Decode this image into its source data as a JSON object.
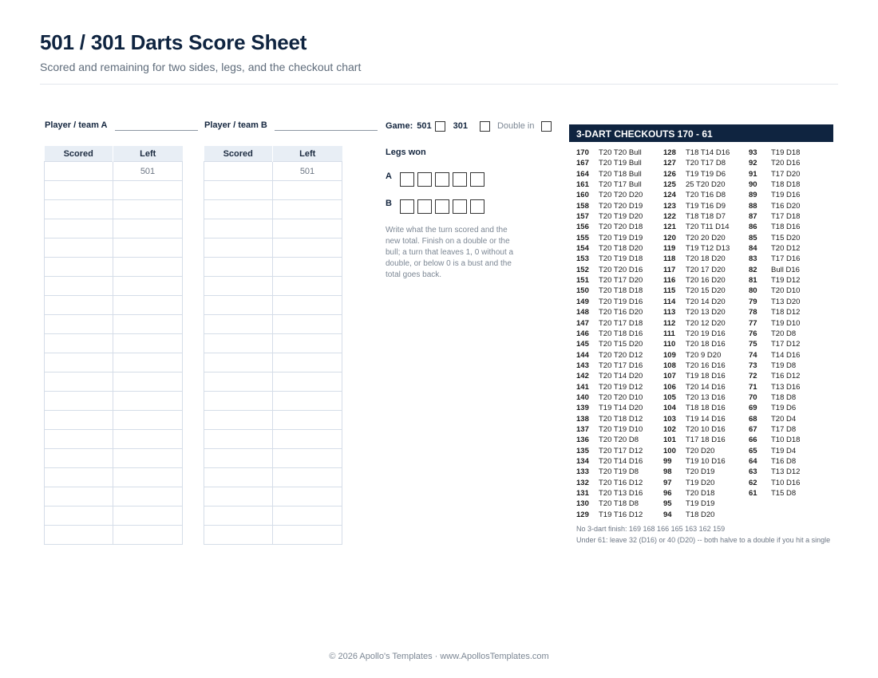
{
  "header": {
    "title": "501 / 301 Darts Score Sheet",
    "subtitle": "Scored and remaining for two sides, legs, and the checkout chart"
  },
  "players": {
    "a_label": "Player / team A",
    "b_label": "Player / team B"
  },
  "game": {
    "label": "Game:",
    "opt1": "501",
    "opt2": "301",
    "double_in": "Double in"
  },
  "sheet": {
    "col_scored": "Scored",
    "col_left": "Left",
    "start_left": "501",
    "rows": 20
  },
  "legs": {
    "title": "Legs won",
    "row_a": "A",
    "row_b": "B",
    "boxes": 5
  },
  "note": "Write what the turn scored and the new total. Finish on a double or the bull; a turn that leaves 1, 0 without a double, or below 0 is a bust and the total goes back.",
  "checkouts": {
    "heading": "3-DART CHECKOUTS  170 - 61",
    "columns": [
      [
        [
          "170",
          "T20 T20 Bull"
        ],
        [
          "167",
          "T20 T19 Bull"
        ],
        [
          "164",
          "T20 T18 Bull"
        ],
        [
          "161",
          "T20 T17 Bull"
        ],
        [
          "160",
          "T20 T20 D20"
        ],
        [
          "158",
          "T20 T20 D19"
        ],
        [
          "157",
          "T20 T19 D20"
        ],
        [
          "156",
          "T20 T20 D18"
        ],
        [
          "155",
          "T20 T19 D19"
        ],
        [
          "154",
          "T20 T18 D20"
        ],
        [
          "153",
          "T20 T19 D18"
        ],
        [
          "152",
          "T20 T20 D16"
        ],
        [
          "151",
          "T20 T17 D20"
        ],
        [
          "150",
          "T20 T18 D18"
        ],
        [
          "149",
          "T20 T19 D16"
        ],
        [
          "148",
          "T20 T16 D20"
        ],
        [
          "147",
          "T20 T17 D18"
        ],
        [
          "146",
          "T20 T18 D16"
        ],
        [
          "145",
          "T20 T15 D20"
        ],
        [
          "144",
          "T20 T20 D12"
        ],
        [
          "143",
          "T20 T17 D16"
        ],
        [
          "142",
          "T20 T14 D20"
        ],
        [
          "141",
          "T20 T19 D12"
        ],
        [
          "140",
          "T20 T20 D10"
        ],
        [
          "139",
          "T19 T14 D20"
        ],
        [
          "138",
          "T20 T18 D12"
        ],
        [
          "137",
          "T20 T19 D10"
        ],
        [
          "136",
          "T20 T20 D8"
        ],
        [
          "135",
          "T20 T17 D12"
        ],
        [
          "134",
          "T20 T14 D16"
        ],
        [
          "133",
          "T20 T19 D8"
        ],
        [
          "132",
          "T20 T16 D12"
        ],
        [
          "131",
          "T20 T13 D16"
        ],
        [
          "130",
          "T20 T18 D8"
        ],
        [
          "129",
          "T19 T16 D12"
        ]
      ],
      [
        [
          "128",
          "T18 T14 D16"
        ],
        [
          "127",
          "T20 T17 D8"
        ],
        [
          "126",
          "T19 T19 D6"
        ],
        [
          "125",
          "25 T20 D20"
        ],
        [
          "124",
          "T20 T16 D8"
        ],
        [
          "123",
          "T19 T16 D9"
        ],
        [
          "122",
          "T18 T18 D7"
        ],
        [
          "121",
          "T20 T11 D14"
        ],
        [
          "120",
          "T20 20 D20"
        ],
        [
          "119",
          "T19 T12 D13"
        ],
        [
          "118",
          "T20 18 D20"
        ],
        [
          "117",
          "T20 17 D20"
        ],
        [
          "116",
          "T20 16 D20"
        ],
        [
          "115",
          "T20 15 D20"
        ],
        [
          "114",
          "T20 14 D20"
        ],
        [
          "113",
          "T20 13 D20"
        ],
        [
          "112",
          "T20 12 D20"
        ],
        [
          "111",
          "T20 19 D16"
        ],
        [
          "110",
          "T20 18 D16"
        ],
        [
          "109",
          "T20 9 D20"
        ],
        [
          "108",
          "T20 16 D16"
        ],
        [
          "107",
          "T19 18 D16"
        ],
        [
          "106",
          "T20 14 D16"
        ],
        [
          "105",
          "T20 13 D16"
        ],
        [
          "104",
          "T18 18 D16"
        ],
        [
          "103",
          "T19 14 D16"
        ],
        [
          "102",
          "T20 10 D16"
        ],
        [
          "101",
          "T17 18 D16"
        ],
        [
          "100",
          "T20 D20"
        ],
        [
          "99",
          "T19 10 D16"
        ],
        [
          "98",
          "T20 D19"
        ],
        [
          "97",
          "T19 D20"
        ],
        [
          "96",
          "T20 D18"
        ],
        [
          "95",
          "T19 D19"
        ],
        [
          "94",
          "T18 D20"
        ]
      ],
      [
        [
          "93",
          "T19 D18"
        ],
        [
          "92",
          "T20 D16"
        ],
        [
          "91",
          "T17 D20"
        ],
        [
          "90",
          "T18 D18"
        ],
        [
          "89",
          "T19 D16"
        ],
        [
          "88",
          "T16 D20"
        ],
        [
          "87",
          "T17 D18"
        ],
        [
          "86",
          "T18 D16"
        ],
        [
          "85",
          "T15 D20"
        ],
        [
          "84",
          "T20 D12"
        ],
        [
          "83",
          "T17 D16"
        ],
        [
          "82",
          "Bull D16"
        ],
        [
          "81",
          "T19 D12"
        ],
        [
          "80",
          "T20 D10"
        ],
        [
          "79",
          "T13 D20"
        ],
        [
          "78",
          "T18 D12"
        ],
        [
          "77",
          "T19 D10"
        ],
        [
          "76",
          "T20 D8"
        ],
        [
          "75",
          "T17 D12"
        ],
        [
          "74",
          "T14 D16"
        ],
        [
          "73",
          "T19 D8"
        ],
        [
          "72",
          "T16 D12"
        ],
        [
          "71",
          "T13 D16"
        ],
        [
          "70",
          "T18 D8"
        ],
        [
          "69",
          "T19 D6"
        ],
        [
          "68",
          "T20 D4"
        ],
        [
          "67",
          "T17 D8"
        ],
        [
          "66",
          "T10 D18"
        ],
        [
          "65",
          "T19 D4"
        ],
        [
          "64",
          "T16 D8"
        ],
        [
          "63",
          "T13 D12"
        ],
        [
          "62",
          "T10 D16"
        ],
        [
          "61",
          "T15 D8"
        ]
      ]
    ],
    "foot1": "No 3-dart finish: 169 168 166 165 163 162 159",
    "foot2": "Under 61: leave 32 (D16) or 40 (D20) -- both halve to a double if you hit a single"
  },
  "footer": "© 2026 Apollo's Templates  ·  www.ApollosTemplates.com"
}
